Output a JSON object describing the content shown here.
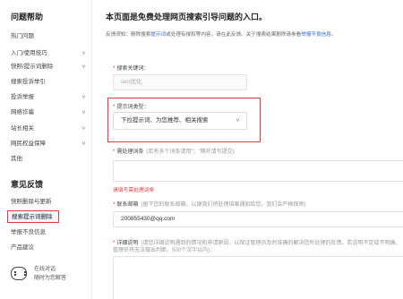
{
  "sidebar": {
    "section1_title": "问题帮助",
    "items": [
      {
        "label": "热门问题",
        "chevron": false
      },
      {
        "label": "入门/使用技巧",
        "chevron": true
      },
      {
        "label": "快照/提示词删除",
        "chevron": true
      },
      {
        "label": "搜索投诉举引",
        "chevron": false
      },
      {
        "label": "投诉举报",
        "chevron": true
      },
      {
        "label": "网络诈骗",
        "chevron": true
      },
      {
        "label": "站长相关",
        "chevron": true
      },
      {
        "label": "网民权益保障",
        "chevron": true
      },
      {
        "label": "其他",
        "chevron": false
      }
    ],
    "section2_title": "意见反馈",
    "feedback_items": [
      {
        "label": "快照删除与更新",
        "active": false
      },
      {
        "label": "搜索提示词删除",
        "active": true
      },
      {
        "label": "举报不良信息",
        "active": false
      },
      {
        "label": "产品建议",
        "active": false
      }
    ],
    "help": {
      "line1": "在线对话",
      "line2": "随时为您解答",
      "icon": "chat-icon"
    }
  },
  "main": {
    "title": "本页面是免费处理网页搜索引导问题的入口。",
    "notice_prefix": "反馈须知：删除搜索",
    "notice_link1": "提示词",
    "notice_mid": "或处理有侵权等内容，请在此反馈。关于搜索结果删除请参看",
    "notice_link2": "举报不良信息",
    "notice_suffix": "。",
    "keyword": {
      "label": "搜索关键词：",
      "value": "seo优化"
    },
    "type": {
      "label": "提示词类型：",
      "value": "下拉提示词、为您推荐、相关搜索"
    },
    "term": {
      "label": "需处理词条",
      "hint": "(若有多个词条请用\"；\"隔开请写提交)",
      "placeholder": "",
      "error": "请填写需处理词条"
    },
    "contact": {
      "label": "联系邮箱",
      "hint": "(留下您的联系邮箱，以便我们将处理结果通知给您，我们会严格保密)",
      "value": "200855430@qq.com"
    },
    "detail": {
      "label": "详细说明",
      "hint": "(请您详细说明遇到的情况和申请原因，以保证管理员及时准确的解决您所处理的反馈。若说明不足或不明确，管理员将无法做出判断。500个汉字以内)："
    }
  },
  "colors": {
    "accent": "#e4393c",
    "link": "#2a67d8"
  }
}
